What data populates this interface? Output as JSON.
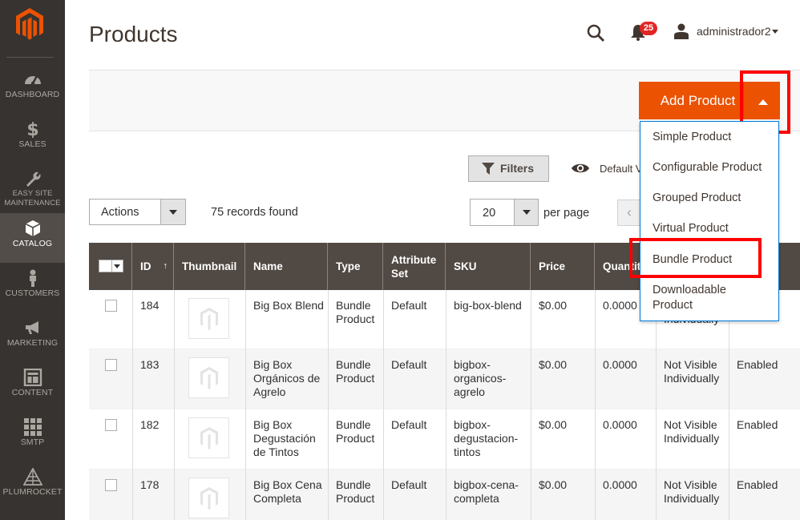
{
  "sidebar": {
    "items": [
      {
        "label": "DASHBOARD",
        "icon": "gauge-icon"
      },
      {
        "label": "SALES",
        "icon": "dollar-icon"
      },
      {
        "label": "EASY SITE",
        "label2": "MAINTENANCE",
        "icon": "wrench-icon"
      },
      {
        "label": "CATALOG",
        "icon": "cube-icon"
      },
      {
        "label": "CUSTOMERS",
        "icon": "person-icon"
      },
      {
        "label": "MARKETING",
        "icon": "megaphone-icon"
      },
      {
        "label": "CONTENT",
        "icon": "layout-icon"
      },
      {
        "label": "SMTP",
        "icon": "grid-icon"
      },
      {
        "label": "PLUMROCKET",
        "icon": "pyramid-icon"
      }
    ],
    "active": "CATALOG"
  },
  "header": {
    "title": "Products",
    "notifications_count": "25",
    "user": "administrador2"
  },
  "toolbar": {
    "add_product_label": "Add Product",
    "add_menu": [
      "Simple Product",
      "Configurable Product",
      "Grouped Product",
      "Virtual Product",
      "Bundle Product",
      "Downloadable Product"
    ],
    "filters_label": "Filters",
    "view_label": "Default V",
    "actions_label": "Actions",
    "records_found": "75 records found",
    "per_page_value": "20",
    "per_page_label": "per page",
    "prev_label": "‹"
  },
  "grid": {
    "columns": [
      "ID",
      "Thumbnail",
      "Name",
      "Type",
      "Attribute Set",
      "SKU",
      "Price",
      "Quantity",
      "",
      ""
    ],
    "rows": [
      {
        "id": "184",
        "name": "Big Box Blend",
        "type": "Bundle Product",
        "attribute_set": "Default",
        "sku": "big-box-blend",
        "price": "$0.00",
        "quantity": "0.0000",
        "visibility": "Individually",
        "status": ""
      },
      {
        "id": "183",
        "name": "Big Box Orgánicos de Agrelo",
        "type": "Bundle Product",
        "attribute_set": "Default",
        "sku": "bigbox-organicos-agrelo",
        "price": "$0.00",
        "quantity": "0.0000",
        "visibility": "Not Visible Individually",
        "status": "Enabled"
      },
      {
        "id": "182",
        "name": "Big Box Degustación de Tintos",
        "type": "Bundle Product",
        "attribute_set": "Default",
        "sku": "bigbox-degustacion-tintos",
        "price": "$0.00",
        "quantity": "0.0000",
        "visibility": "Not Visible Individually",
        "status": "Enabled"
      },
      {
        "id": "178",
        "name": "Big Box Cena Completa",
        "type": "Bundle Product",
        "attribute_set": "Default",
        "sku": "bigbox-cena-completa",
        "price": "$0.00",
        "quantity": "0.0000",
        "visibility": "Not Visible Individually",
        "status": "Enabled"
      }
    ]
  },
  "colors": {
    "accent": "#eb5202",
    "sidebar": "#373330",
    "grid_header": "#514943",
    "highlight": "#ff0000"
  }
}
